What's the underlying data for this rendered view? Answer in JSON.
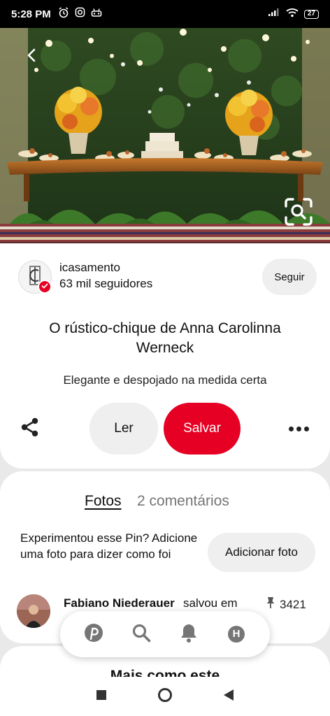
{
  "status_bar": {
    "time": "5:28 PM",
    "battery": "27",
    "left_icons": [
      "alarm-icon",
      "instagram-icon",
      "notification-icon"
    ],
    "right_icons": [
      "signal-icon",
      "wifi-icon",
      "battery-icon"
    ]
  },
  "hero": {
    "icons": [
      "back-arrow-icon",
      "visual-search-icon"
    ]
  },
  "creator": {
    "name": "icasamento",
    "followers": "63 mil seguidores",
    "follow_label": "Seguir",
    "avatar_icon": "cent-logo-icon",
    "verified_icon": "check-icon"
  },
  "pin": {
    "title": "O rústico-chique de Anna Carolinna Werneck",
    "description": "Elegante e despojado na medida certa"
  },
  "actions": {
    "share_icon": "share-icon",
    "read_label": "Ler",
    "save_label": "Salvar",
    "more_icon": "more-dots-icon"
  },
  "photos": {
    "tab_photos": "Fotos",
    "tab_comments": "2 comentários",
    "tried_text": "Experimentou esse Pin? Adicione uma foto para dizer como foi",
    "add_photo_label": "Adicionar foto"
  },
  "activity": {
    "name": "Fabiano Niederauer",
    "action": "salvou em",
    "save_count": "3421",
    "pin_icon": "pushpin-icon"
  },
  "more_like_this": {
    "title": "Mais como este"
  },
  "bottom_nav": {
    "items": [
      "pinterest-home-icon",
      "search-icon",
      "bell-icon",
      "profile-icon"
    ],
    "profile_initial": "H"
  },
  "system_nav": {
    "items": [
      "recents-square-icon",
      "home-circle-icon",
      "back-triangle-icon"
    ]
  },
  "colors": {
    "accent": "#e60023",
    "button_gray": "#efefef",
    "secondary_text": "#767676"
  }
}
